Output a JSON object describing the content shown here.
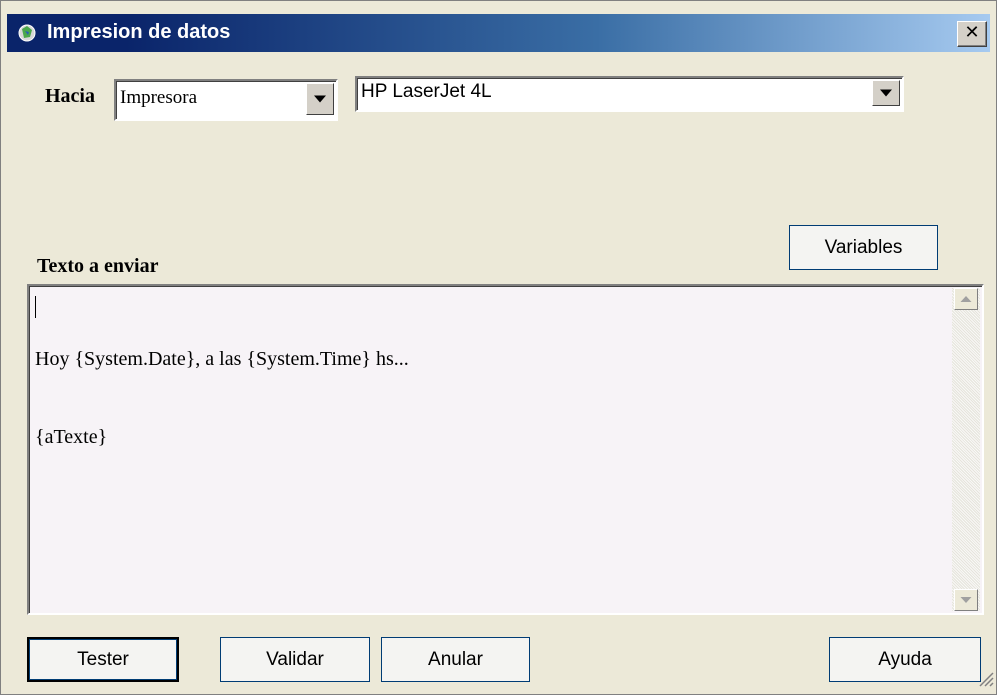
{
  "window": {
    "title": "Impresion de datos",
    "close_label": "x"
  },
  "target": {
    "label": "Hacia",
    "selected": "Impresora",
    "printer_selected": "HP LaserJet 4L"
  },
  "variables_button": "Variables",
  "text_section": {
    "label": "Texto a enviar",
    "lines": [
      "Hoy {System.Date}, a las {System.Time} hs...",
      "{aTexte}"
    ]
  },
  "buttons": {
    "tester": "Tester",
    "validar": "Validar",
    "anular": "Anular",
    "ayuda": "Ayuda"
  },
  "colors": {
    "titlebar_start": "#0a246a",
    "titlebar_end": "#a6caf0",
    "dialog_bg": "#ece9d8",
    "textarea_bg": "#f7f3f7"
  },
  "icons": {
    "app": "printer-app-icon",
    "close": "close-icon",
    "dropdown": "chevron-down-icon",
    "scroll_up": "scroll-up-arrow-icon",
    "scroll_down": "scroll-down-arrow-icon"
  }
}
